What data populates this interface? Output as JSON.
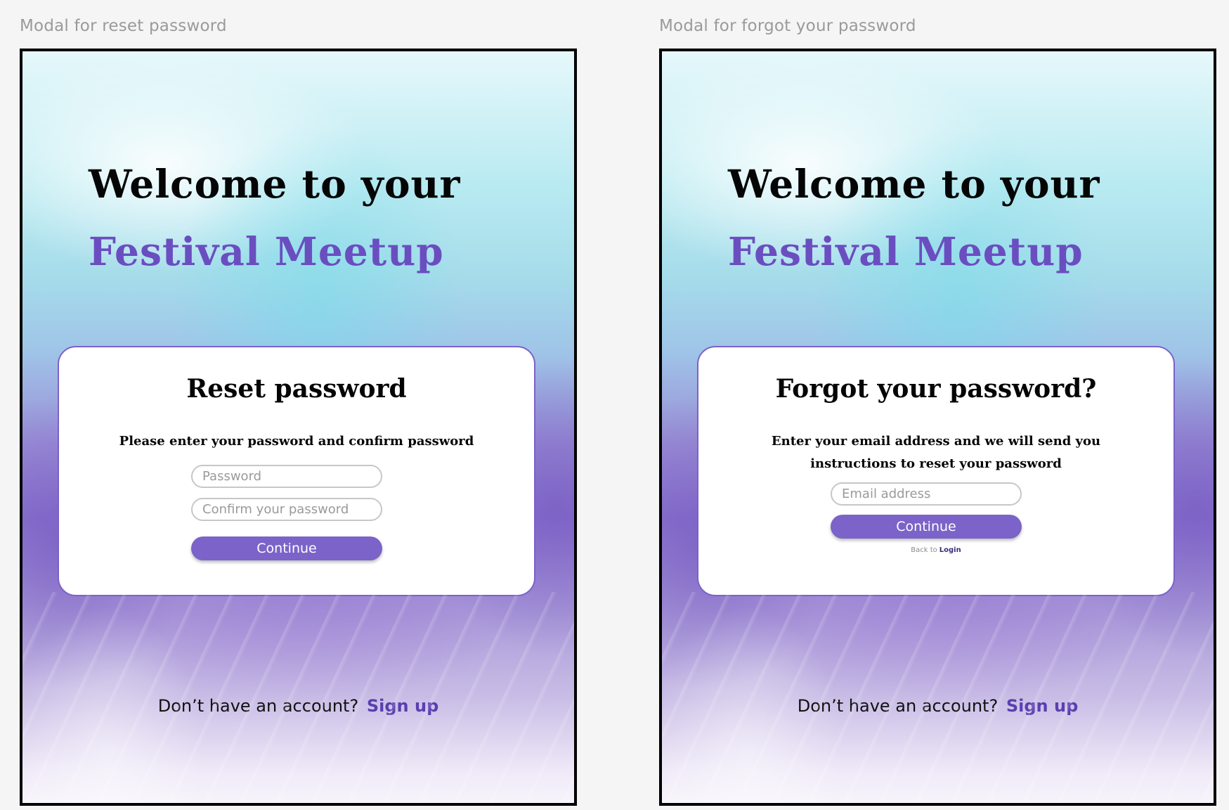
{
  "colors": {
    "canvas": "#f5f5f5",
    "brand_purple": "#6a4ec0",
    "button_purple": "#7b63c9",
    "frame_border": "#000000"
  },
  "frames": [
    {
      "caption": "Modal for reset password",
      "welcome": "Welcome to your",
      "brand": "Festival Meetup",
      "card": {
        "title": "Reset password",
        "instruction": "Please enter your password and confirm password",
        "fields": [
          {
            "placeholder": "Password"
          },
          {
            "placeholder": "Confirm your password"
          }
        ],
        "continue_label": "Continue"
      },
      "footer": {
        "prompt": "Don’t have an account?",
        "signup_label": "Sign up"
      }
    },
    {
      "caption": "Modal for forgot your password",
      "welcome": "Welcome to your",
      "brand": "Festival Meetup",
      "card": {
        "title": "Forgot your password?",
        "instruction": "Enter your email address and we will send you instructions to reset your password",
        "fields": [
          {
            "placeholder": "Email address"
          }
        ],
        "continue_label": "Continue",
        "back_prefix": "Back to",
        "back_link": "Login"
      },
      "footer": {
        "prompt": "Don’t have an account?",
        "signup_label": "Sign up"
      }
    }
  ]
}
